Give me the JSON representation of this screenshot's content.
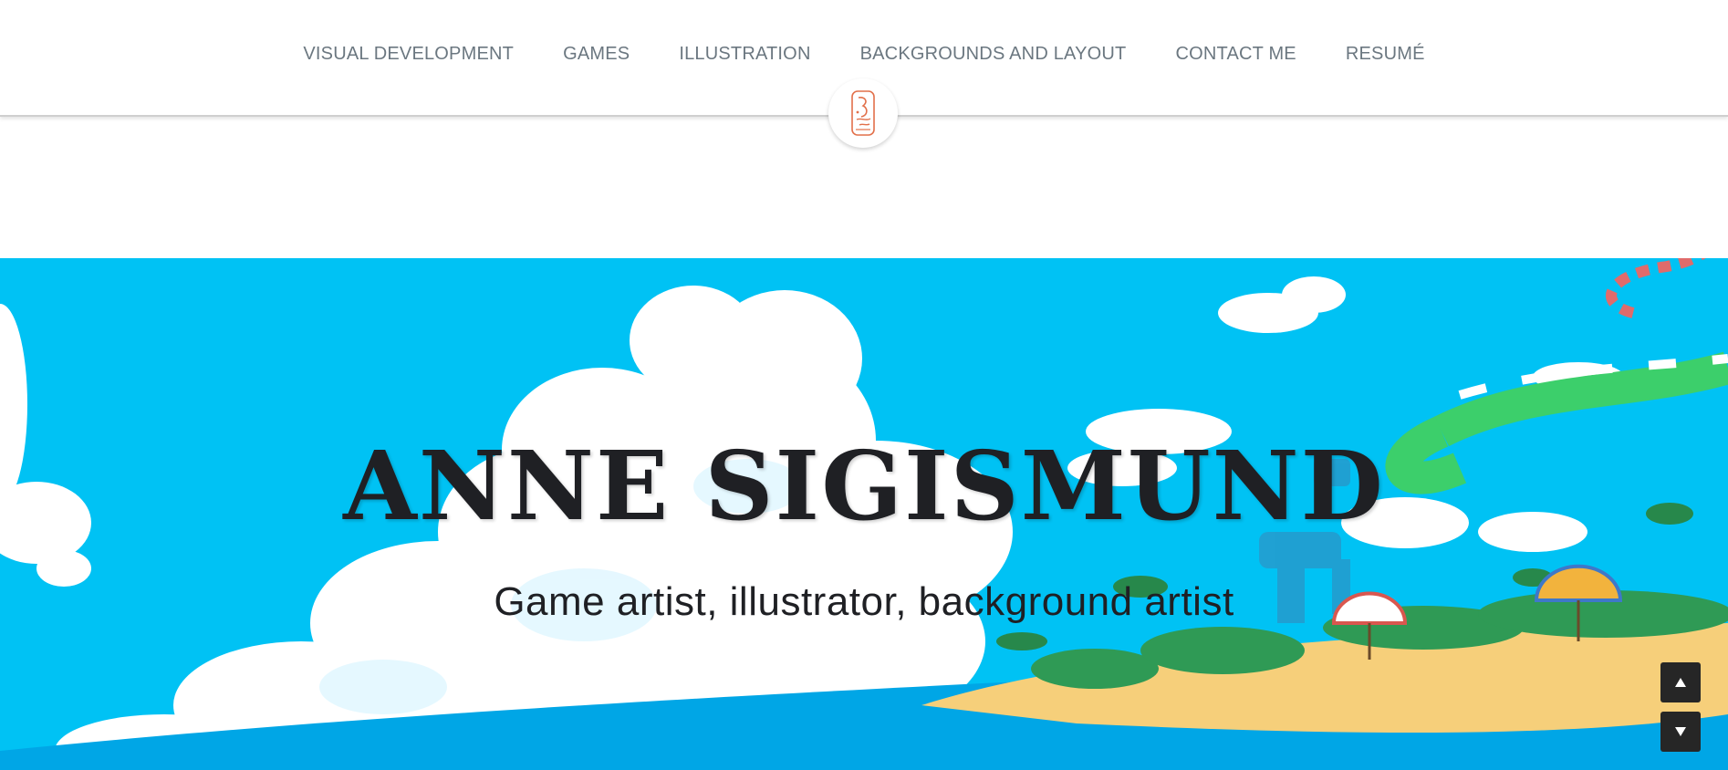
{
  "nav": {
    "items": [
      {
        "label": "VISUAL DEVELOPMENT"
      },
      {
        "label": "GAMES"
      },
      {
        "label": "ILLUSTRATION"
      },
      {
        "label": "BACKGROUNDS AND LAYOUT"
      },
      {
        "label": "CONTACT ME"
      },
      {
        "label": "RESUMÉ"
      }
    ]
  },
  "logo": {
    "icon": "monogram-logo-icon",
    "color": "#e2704a"
  },
  "hero": {
    "title": "ANNE SIGISMUND",
    "subtitle": "Game artist, illustrator, background artist",
    "sky_color": "#00c2f4"
  },
  "scroll": {
    "up_icon": "triangle-up-icon",
    "down_icon": "triangle-down-icon"
  }
}
